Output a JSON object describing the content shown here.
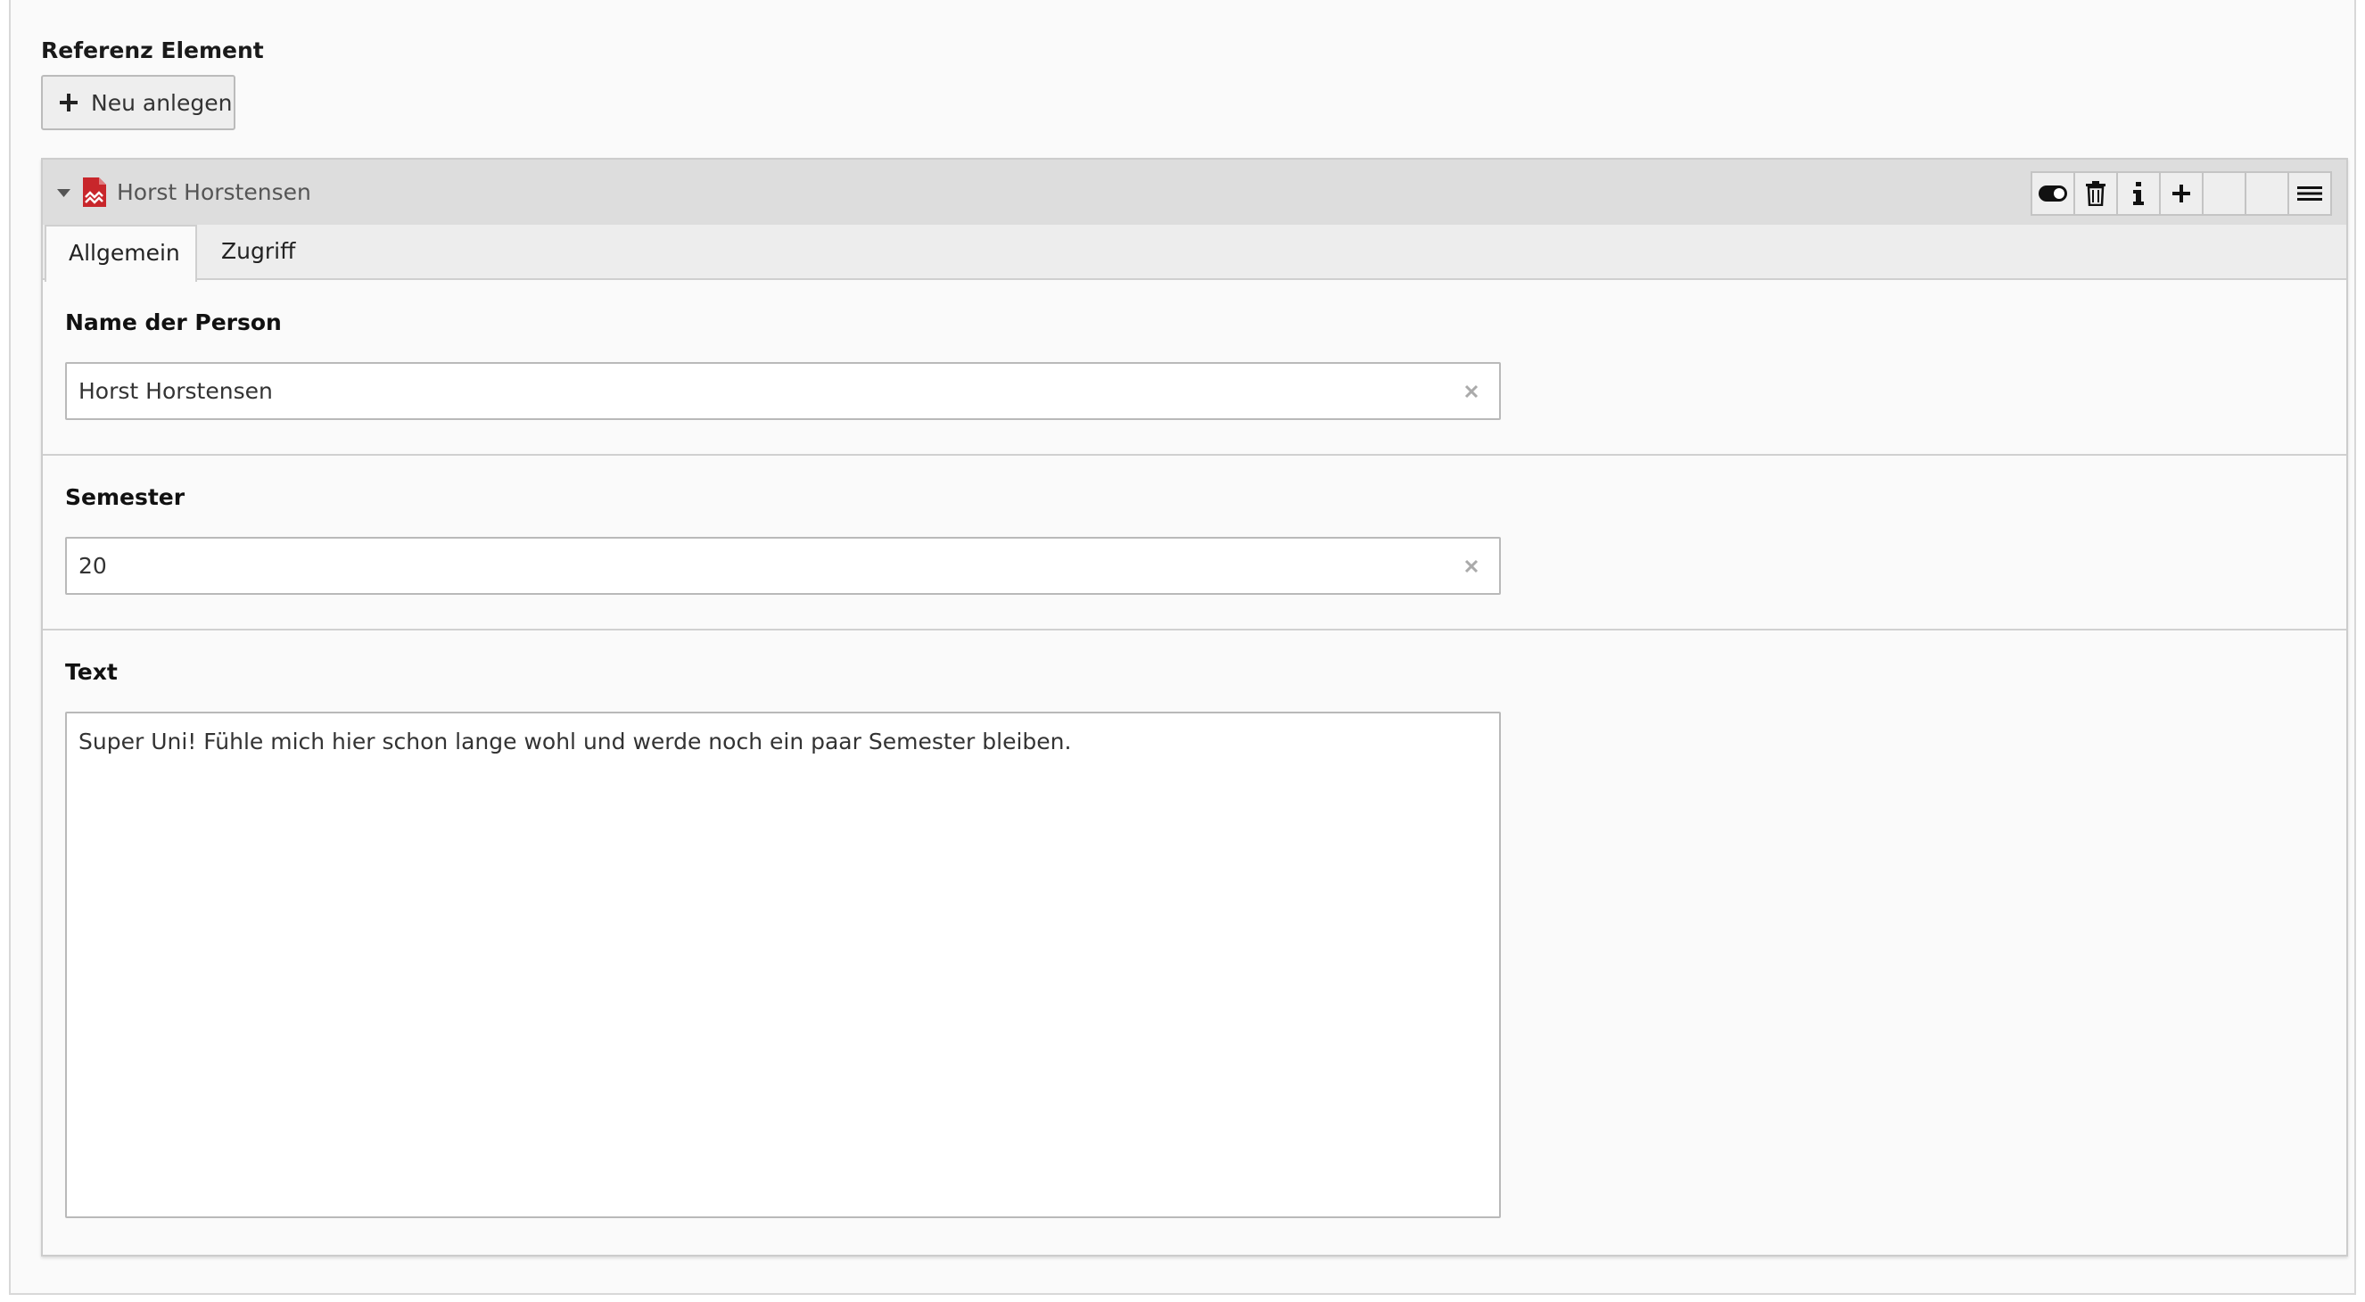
{
  "section": {
    "label": "Referenz Element",
    "new_button_label": "Neu anlegen"
  },
  "record": {
    "title": "Horst Horstensen",
    "icon": "content-element-red-icon",
    "controls": [
      "toggle-visibility-icon",
      "delete-icon",
      "info-icon",
      "add-icon",
      "move-up-placeholder",
      "move-down-placeholder",
      "drag-handle-icon"
    ],
    "tabs": [
      {
        "label": "Allgemein",
        "active": true
      },
      {
        "label": "Zugriff",
        "active": false
      }
    ],
    "fields": {
      "name": {
        "label": "Name der Person",
        "value": "Horst Horstensen"
      },
      "semester": {
        "label": "Semester",
        "value": "20"
      },
      "text": {
        "label": "Text",
        "value": "Super Uni! Fühle mich hier schon lange wohl und werde noch ein paar Semester bleiben."
      }
    }
  },
  "colors": {
    "icon_red": "#c8262b",
    "header_bg": "#dddddd",
    "panel_bg": "#fafafa"
  }
}
